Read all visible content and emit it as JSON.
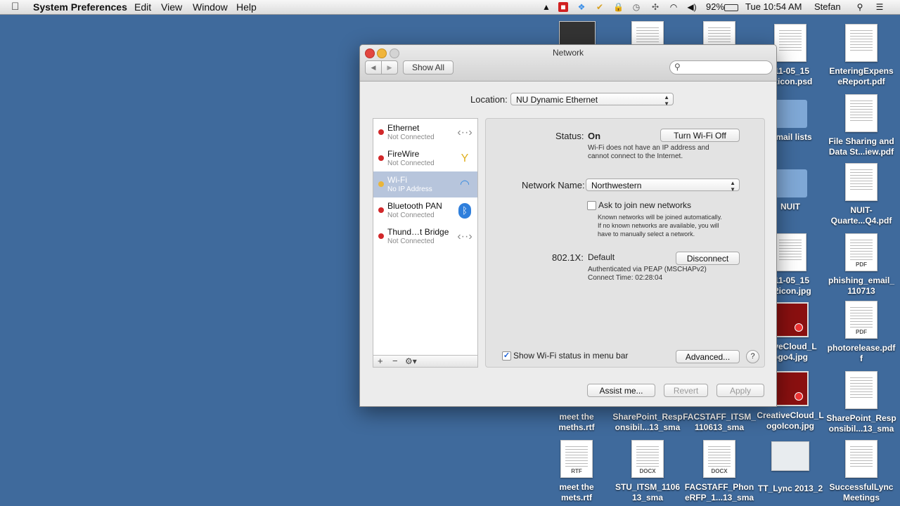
{
  "menubar": {
    "app_name": "System Preferences",
    "menus": [
      "Edit",
      "View",
      "Window",
      "Help"
    ],
    "battery": "92%",
    "clock": "Tue 10:54 AM",
    "user": "Stefan"
  },
  "desktop": {
    "icons": [
      {
        "label": "",
        "kind": "music"
      },
      {
        "label": "",
        "kind": "doc"
      },
      {
        "label": "",
        "kind": "doc"
      },
      {
        "label": "-11-05_15\n52icon.psd",
        "kind": "doc"
      },
      {
        "label": "EnteringExpens\neReport.pdf",
        "kind": "doc"
      },
      {
        "label": "k mail lists",
        "kind": "folder"
      },
      {
        "label": "File Sharing and\nData St...iew.pdf",
        "kind": "doc"
      },
      {
        "label": "NUIT",
        "kind": "folder"
      },
      {
        "label": "NUIT-\nQuarte...Q4.pdf",
        "kind": "doc"
      },
      {
        "label": "-11-05_15\n52icon.jpg",
        "kind": "doc"
      },
      {
        "label": "phishing_email_\n110713",
        "kind": "doc",
        "ext": "PDF"
      },
      {
        "label": "ativeCloud_L\nogo4.jpg",
        "kind": "img"
      },
      {
        "label": "photorelease.pdf\nf",
        "kind": "doc",
        "ext": "PDF"
      },
      {
        "label": "meet the\nmeths.rtf",
        "kind": "none"
      },
      {
        "label": "SharePoint_Resp\nonsibil...13_sma",
        "kind": "none"
      },
      {
        "label": "FACSTAFF_ITSM_\n110613_sma",
        "kind": "none"
      },
      {
        "label": "CreativeCloud_L\nogoIcon.jpg",
        "kind": "img"
      },
      {
        "label": "SharePoint_Resp\nonsibil...13_sma",
        "kind": "doc"
      },
      {
        "label": "meet the\nmets.rtf",
        "kind": "doc",
        "ext": "RTF"
      },
      {
        "label": "STU_ITSM_1106\n13_sma",
        "kind": "doc",
        "ext": "DOCX"
      },
      {
        "label": "FACSTAFF_Phon\neRFP_1...13_sma",
        "kind": "doc",
        "ext": "DOCX"
      },
      {
        "label": "TT_Lync 2013_2",
        "kind": "cert"
      },
      {
        "label": "SuccessfulLync\nMeetings",
        "kind": "doc"
      }
    ]
  },
  "window": {
    "title": "Network",
    "show_all": "Show All",
    "search_placeholder": "",
    "location_label": "Location:",
    "location_value": "NU Dynamic Ethernet",
    "services": [
      {
        "name": "Ethernet",
        "status": "Not Connected",
        "dot": "red",
        "icon": "ethernet-arrows-icon"
      },
      {
        "name": "FireWire",
        "status": "Not Connected",
        "dot": "red",
        "icon": "firewire-icon"
      },
      {
        "name": "Wi-Fi",
        "status": "No IP Address",
        "dot": "yellow",
        "icon": "wifi-icon",
        "selected": true
      },
      {
        "name": "Bluetooth PAN",
        "status": "Not Connected",
        "dot": "red",
        "icon": "bluetooth-icon"
      },
      {
        "name": "Thund…t Bridge",
        "status": "Not Connected",
        "dot": "red",
        "icon": "thunderbolt-arrows-icon"
      }
    ],
    "list_footer": {
      "add": "+",
      "remove": "−",
      "gear": "⚙▾"
    },
    "detail": {
      "status_label": "Status:",
      "status_value": "On",
      "turn_off_button": "Turn Wi-Fi Off",
      "status_desc_1": "Wi-Fi does not have an IP address and",
      "status_desc_2": "cannot connect to the Internet.",
      "network_name_label": "Network Name:",
      "network_name_value": "Northwestern",
      "ask_join_label": "Ask to join new networks",
      "ask_join_checked": false,
      "ask_desc_1": "Known networks will be joined automatically.",
      "ask_desc_2": "If no known networks are available, you will",
      "ask_desc_3": "have to manually select a network.",
      "dot1x_label": "802.1X:",
      "dot1x_value": "Default",
      "disconnect_button": "Disconnect",
      "auth_line": "Authenticated via PEAP (MSCHAPv2)",
      "connect_time": "Connect Time: 02:28:04",
      "show_status_label": "Show Wi-Fi status in menu bar",
      "show_status_checked": true,
      "advanced_button": "Advanced...",
      "help": "?"
    },
    "bottom": {
      "assist": "Assist me...",
      "revert": "Revert",
      "apply": "Apply"
    }
  }
}
